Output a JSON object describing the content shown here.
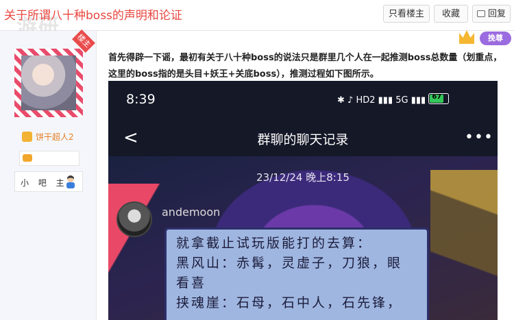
{
  "header": {
    "title": "关于所谓八十种boss的声明和论证",
    "watermark": "游研",
    "buttons": {
      "only_owner": "只看楼主",
      "favorite": "收藏",
      "reply": "回复"
    }
  },
  "author": {
    "owner_badge": "楼主",
    "username": "饼干超人2",
    "role": "小 吧 主"
  },
  "vip": {
    "badge_text": "挽尊"
  },
  "post": {
    "text": "首先得辟一下谣，最初有关于八十种boss的说法只是群里几个人在一起推测boss总数量（划重点，这里的boss指的是头目+妖王+关底boss），推测过程如下图所示。"
  },
  "screenshot": {
    "time": "8:39",
    "status_icons": "✱ ♪ HD2 ▮▮▮ 5G ▮▮▮ ",
    "battery": "67",
    "chat_title": "群聊的聊天记录",
    "back_glyph": "<",
    "more_glyph": "•••",
    "timestamp": "23/12/24 晚上8:15",
    "sender": "andemoon",
    "message_lines": [
      "就拿截止试玩版能打的去算：",
      "黑风山：赤髯，灵虚子，刀狼，眼",
      "看喜",
      "挟魂崖：石母，石中人，石先锋，"
    ]
  }
}
